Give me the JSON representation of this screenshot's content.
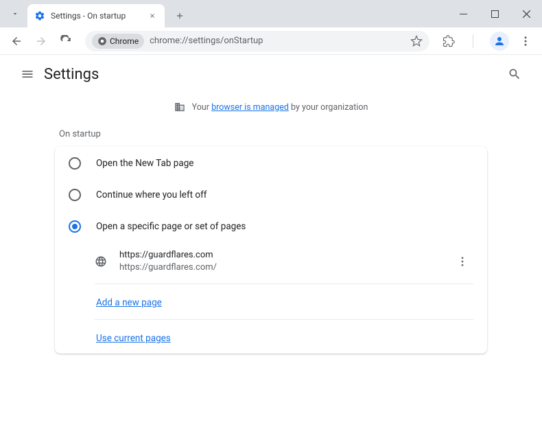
{
  "tab": {
    "title": "Settings - On startup"
  },
  "omnibox": {
    "chip": "Chrome",
    "url": "chrome://settings/onStartup"
  },
  "header": {
    "title": "Settings"
  },
  "banner": {
    "prefix": "Your ",
    "link": "browser is managed",
    "suffix": " by your organization"
  },
  "section": {
    "title": "On startup"
  },
  "options": {
    "opt1": "Open the New Tab page",
    "opt2": "Continue where you left off",
    "opt3": "Open a specific page or set of pages"
  },
  "page_entry": {
    "title": "https://guardflares.com",
    "url": "https://guardflares.com/"
  },
  "links": {
    "add": "Add a new page",
    "use": "Use current pages"
  }
}
